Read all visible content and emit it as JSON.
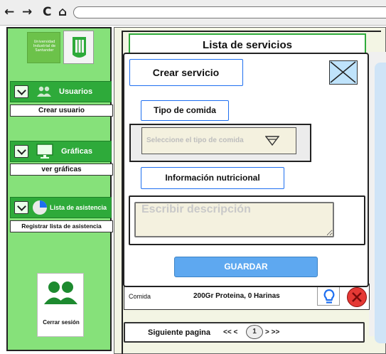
{
  "browser": {
    "back_glyph": "←",
    "forward_glyph": "→",
    "reload_glyph": "C",
    "home_glyph": "⌂"
  },
  "sidebar": {
    "logo_text": "Universidad Industrial de Santander",
    "menus": [
      {
        "label": "Usuarios",
        "icon": "users-icon",
        "sub": "Crear usuario"
      },
      {
        "label": "Gráficas",
        "icon": "monitor-icon",
        "sub": "ver gráficas"
      },
      {
        "label": "Lista de asistencia",
        "icon": "pie-chart-icon",
        "sub": "Registrar lista de asistencia"
      }
    ],
    "logout_label": "Cerrar sesión"
  },
  "main": {
    "title": "Lista de servicios",
    "row": {
      "name": "Comida",
      "info": "200Gr Proteina, 0 Harinas"
    },
    "pager": {
      "label": "Siguiente pagina",
      "prev": "<< <",
      "page": "1",
      "next": "> >>"
    }
  },
  "modal": {
    "title": "Crear servicio",
    "food_type_label": "Tipo de comida",
    "food_type_placeholder": "Seleccione el tipo de comida",
    "nutrition_label": "Información nutricional",
    "description_placeholder": "Escribir descripción",
    "save_label": "GUARDAR"
  },
  "colors": {
    "sidebar_bg": "#86e17a",
    "menu_green": "#2eaa3a",
    "accent_blue": "#1e6ff0",
    "save_blue": "#5ea8f0",
    "delete_red": "#e53935"
  }
}
